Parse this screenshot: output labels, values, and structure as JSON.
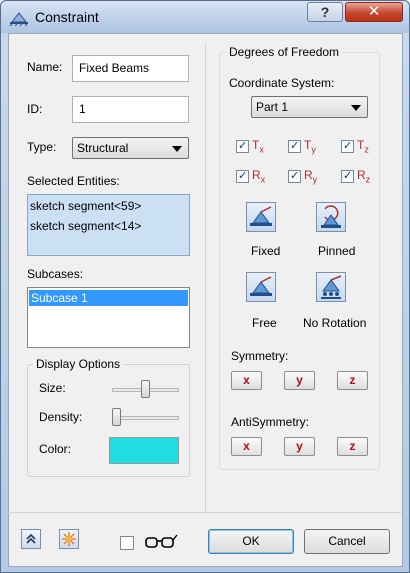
{
  "window": {
    "title": "Constraint",
    "help_label": "?",
    "close_label": "✕"
  },
  "left": {
    "name_label": "Name:",
    "name_value": "Fixed Beams",
    "id_label": "ID:",
    "id_value": "1",
    "type_label": "Type:",
    "type_value": "Structural",
    "selected_entities_label": "Selected Entities:",
    "selected_entities": [
      "sketch segment<59>",
      "sketch segment<14>"
    ],
    "subcases_label": "Subcases:",
    "subcases": [
      "Subcase 1"
    ],
    "display_options": {
      "title": "Display Options",
      "size_label": "Size:",
      "size_level": 0.5,
      "density_label": "Density:",
      "density_level": 0.0,
      "color_label": "Color:",
      "color_value": "#22dde0"
    }
  },
  "dof": {
    "title": "Degrees of Freedom",
    "coord_system_label": "Coordinate System:",
    "coord_system_value": "Part 1",
    "checkboxes": [
      {
        "letter": "T",
        "sub": "x",
        "checked": true
      },
      {
        "letter": "T",
        "sub": "y",
        "checked": true
      },
      {
        "letter": "T",
        "sub": "z",
        "checked": true
      },
      {
        "letter": "R",
        "sub": "x",
        "checked": true
      },
      {
        "letter": "R",
        "sub": "y",
        "checked": true
      },
      {
        "letter": "R",
        "sub": "z",
        "checked": true
      }
    ],
    "presets": [
      {
        "label": "Fixed",
        "icon": "fixed-support-icon"
      },
      {
        "label": "Pinned",
        "icon": "pinned-support-icon"
      },
      {
        "label": "Free",
        "icon": "free-support-icon"
      },
      {
        "label": "No Rotation",
        "icon": "no-rotation-support-icon"
      }
    ],
    "symmetry_label": "Symmetry:",
    "symmetry_buttons": [
      "x",
      "y",
      "z"
    ],
    "antisymmetry_label": "AntiSymmetry:",
    "antisymmetry_buttons": [
      "x",
      "y",
      "z"
    ]
  },
  "footer": {
    "ok_label": "OK",
    "cancel_label": "Cancel",
    "preview_checked": false,
    "expand_icon": "double-chevron-up-icon",
    "highlight_icon": "sparkle-icon",
    "glasses_icon": "glasses-icon"
  },
  "colors": {
    "accent_red": "#b03030",
    "selection_blue": "#3399ff",
    "list_blue_bg": "#cce0f5"
  }
}
